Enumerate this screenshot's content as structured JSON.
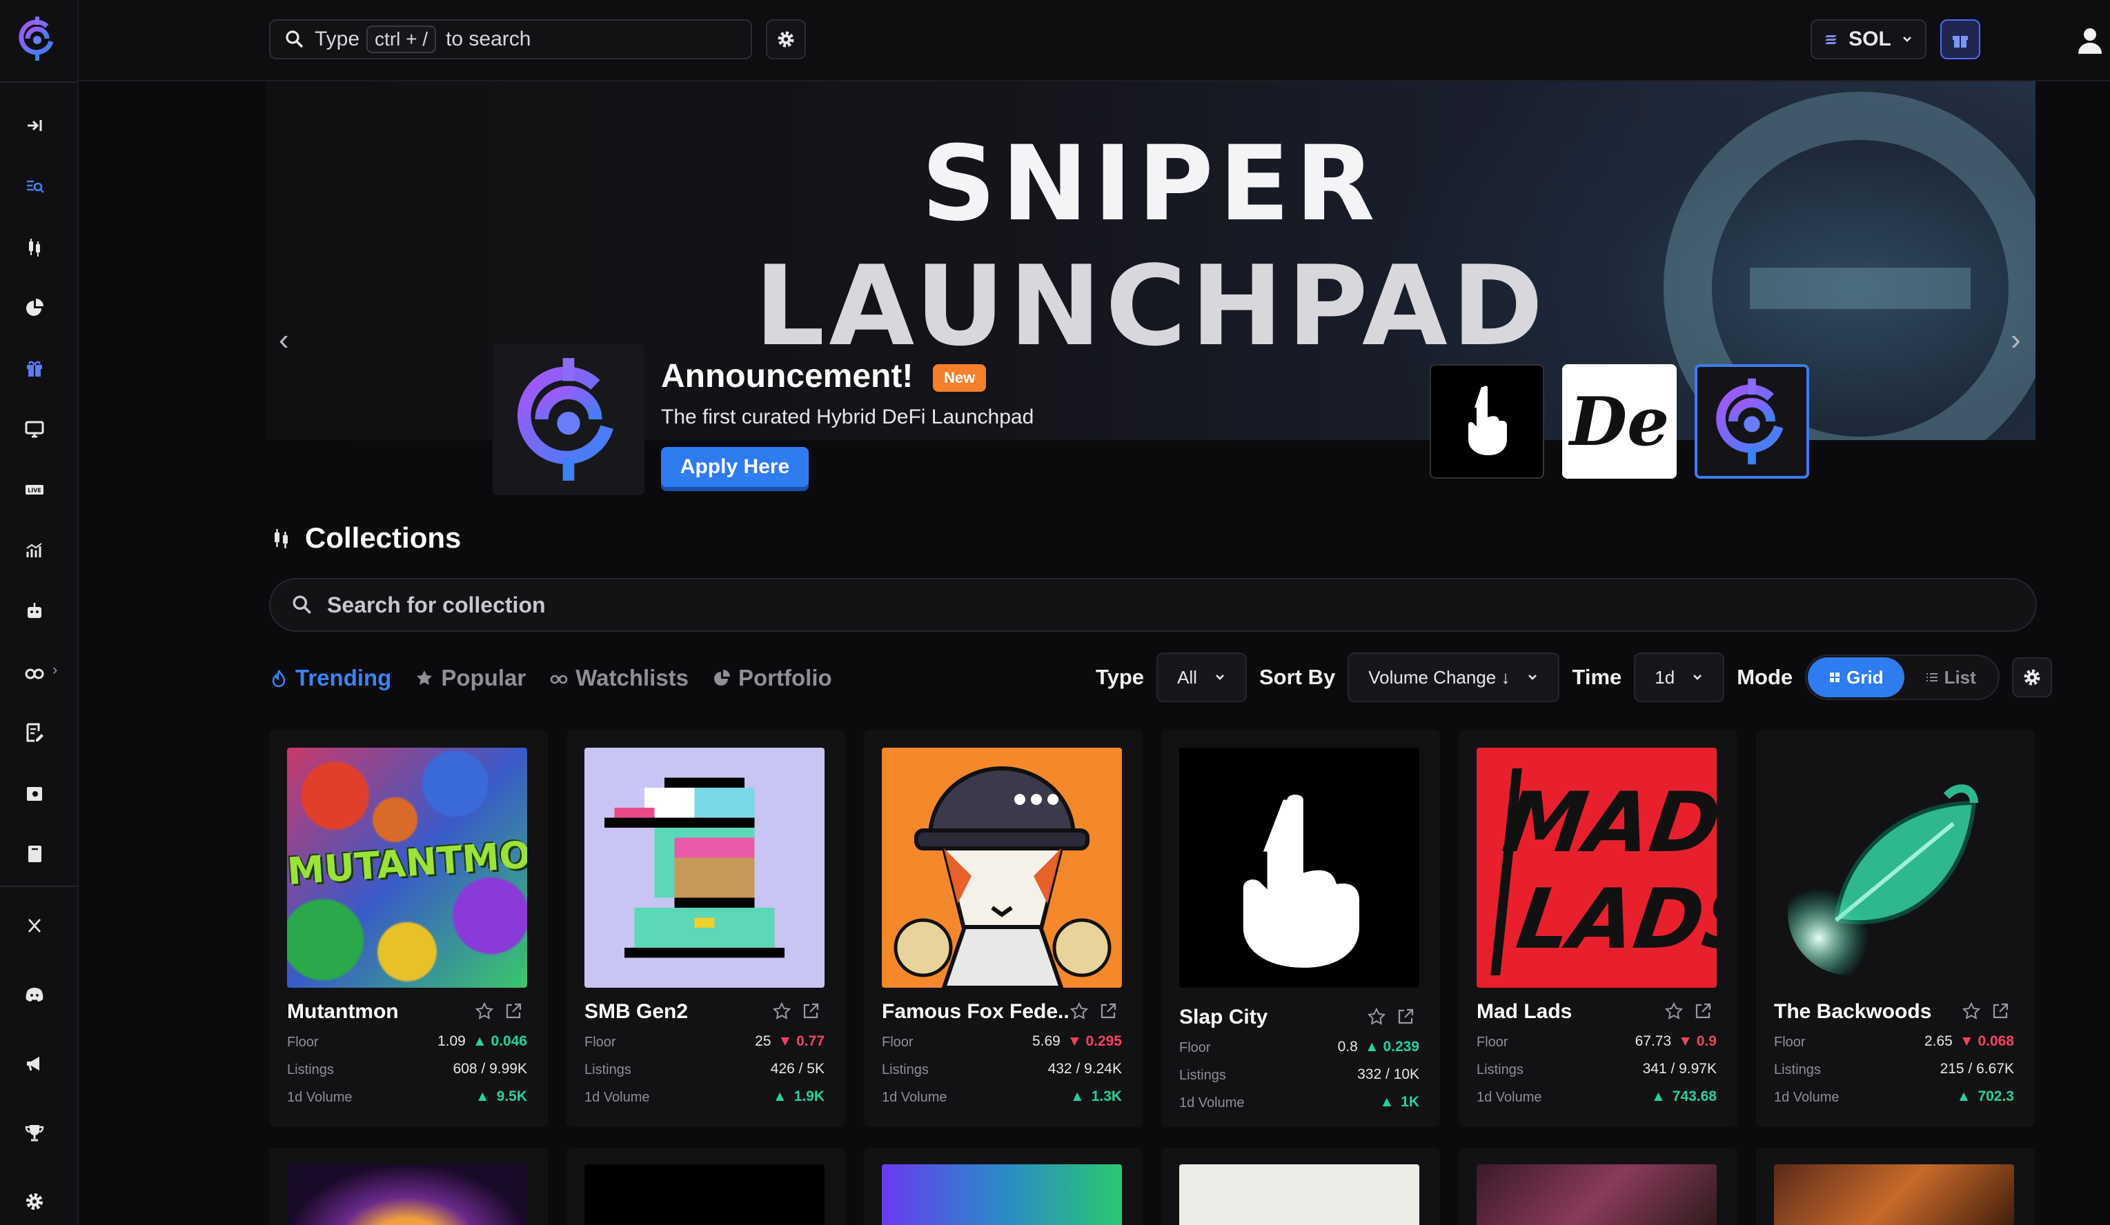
{
  "topbar": {
    "search_prefix": "Type",
    "search_kbd": "ctrl + /",
    "search_suffix": "to search",
    "chain": "SOL"
  },
  "banner": {
    "line1": "SNIPER",
    "line2": "LAUNCHPAD",
    "announcement_title": "Announcement!",
    "new_badge": "New",
    "subtitle": "The first curated Hybrid DeFi Launchpad",
    "apply_label": "Apply Here",
    "thumb_de_text": "De"
  },
  "collections": {
    "title": "Collections",
    "search_placeholder": "Search for collection",
    "tabs": [
      {
        "label": "Trending",
        "icon": "flame-icon"
      },
      {
        "label": "Popular",
        "icon": "star-icon"
      },
      {
        "label": "Watchlists",
        "icon": "binoculars-icon"
      },
      {
        "label": "Portfolio",
        "icon": "pie-chart-icon"
      }
    ],
    "filters": {
      "type_label": "Type",
      "type_value": "All",
      "sort_label": "Sort By",
      "sort_value": "Volume Change ↓",
      "time_label": "Time",
      "time_value": "1d",
      "mode_label": "Mode",
      "mode_grid": "Grid",
      "mode_list": "List"
    },
    "stat_labels": {
      "floor": "Floor",
      "listings": "Listings",
      "volume": "1d Volume"
    },
    "cards": [
      {
        "name": "Mutantmon",
        "floor": "1.09",
        "floor_change": "0.046",
        "floor_dir": "up",
        "listings": "608 / 9.99K",
        "volume": "9.5K",
        "volume_dir": "up"
      },
      {
        "name": "SMB Gen2",
        "floor": "25",
        "floor_change": "0.77",
        "floor_dir": "down",
        "listings": "426 / 5K",
        "volume": "1.9K",
        "volume_dir": "up"
      },
      {
        "name": "Famous Fox Fede...",
        "floor": "5.69",
        "floor_change": "0.295",
        "floor_dir": "down",
        "listings": "432 / 9.24K",
        "volume": "1.3K",
        "volume_dir": "up"
      },
      {
        "name": "Slap City",
        "floor": "0.8",
        "floor_change": "0.239",
        "floor_dir": "up",
        "listings": "332 / 10K",
        "volume": "1K",
        "volume_dir": "up"
      },
      {
        "name": "Mad Lads",
        "floor": "67.73",
        "floor_change": "0.9",
        "floor_dir": "down",
        "listings": "341 / 9.97K",
        "volume": "743.68",
        "volume_dir": "up"
      },
      {
        "name": "The Backwoods",
        "floor": "2.65",
        "floor_change": "0.068",
        "floor_dir": "down",
        "listings": "215 / 6.67K",
        "volume": "702.3",
        "volume_dir": "up"
      }
    ],
    "art_text": {
      "mutantmon": "MUTANTMON",
      "madlads_1": "MAD",
      "madlads_2": "LADS"
    }
  },
  "colors": {
    "accent": "#2f7bf0",
    "up": "#22d39a",
    "down": "#f0445c",
    "new_badge": "#f5802c"
  }
}
